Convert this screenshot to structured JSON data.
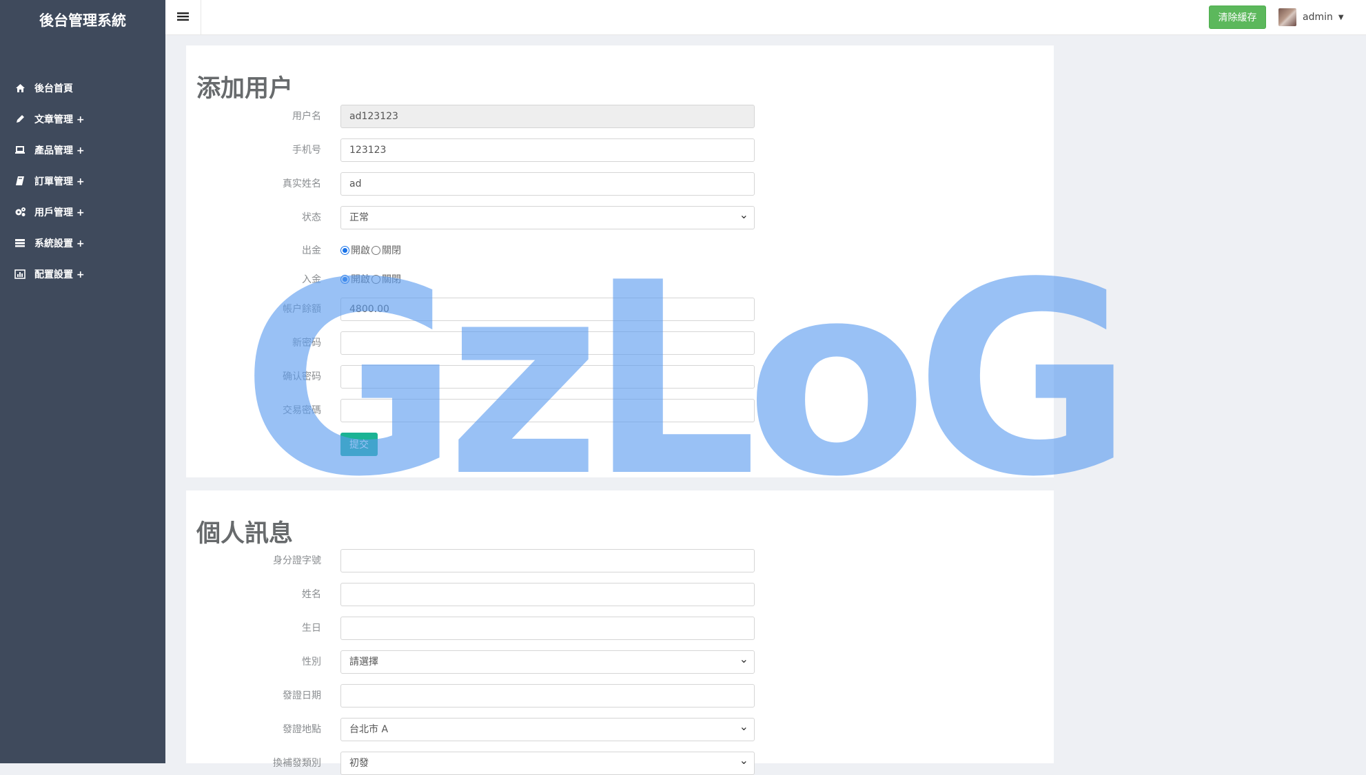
{
  "sidebar": {
    "brand": "後台管理系統",
    "items": [
      {
        "label": "後台首頁",
        "icon": "home-icon"
      },
      {
        "label": "文章管理 +",
        "icon": "pencil-icon"
      },
      {
        "label": "產品管理 +",
        "icon": "laptop-icon"
      },
      {
        "label": "訂單管理 +",
        "icon": "book-icon"
      },
      {
        "label": "用戶管理 +",
        "icon": "gears-icon"
      },
      {
        "label": "系統設置 +",
        "icon": "server-icon"
      },
      {
        "label": "配置設置 +",
        "icon": "chart-icon"
      }
    ]
  },
  "topbar": {
    "clear_cache": "清除緩存",
    "username": "admin"
  },
  "add_user": {
    "title": "添加用户",
    "fields": {
      "username": {
        "label": "用户名",
        "value": "ad123123"
      },
      "phone": {
        "label": "手机号",
        "value": "123123"
      },
      "realname": {
        "label": "真实姓名",
        "value": "ad"
      },
      "status": {
        "label": "状态",
        "value": "正常"
      },
      "withdraw": {
        "label": "出金",
        "on": "開啟",
        "off": "關閉"
      },
      "deposit": {
        "label": "入金",
        "on": "開啟",
        "off": "關閉"
      },
      "balance": {
        "label": "帳户餘額",
        "value": "4800.00"
      },
      "new_password": {
        "label": "新密码",
        "value": ""
      },
      "confirm_password": {
        "label": "确认密码",
        "value": ""
      },
      "trade_password": {
        "label": "交易密碼",
        "value": ""
      }
    },
    "submit": "提交"
  },
  "personal": {
    "title": "個人訊息",
    "fields": {
      "id_number": {
        "label": "身分證字號",
        "value": ""
      },
      "name": {
        "label": "姓名",
        "value": ""
      },
      "birthday": {
        "label": "生日",
        "value": ""
      },
      "gender": {
        "label": "性別",
        "value": "請選擇"
      },
      "issue_date": {
        "label": "發證日期",
        "value": ""
      },
      "issue_place": {
        "label": "發證地點",
        "value": "台北市 A"
      },
      "reissue_type": {
        "label": "換補發類別",
        "value": "初發"
      }
    }
  },
  "watermark": "GzLoG",
  "colors": {
    "sidebar_bg": "#3f4a5c",
    "clear_btn": "#5cb85c",
    "submit_btn": "#1ab394",
    "watermark": "#5b9cf0"
  }
}
